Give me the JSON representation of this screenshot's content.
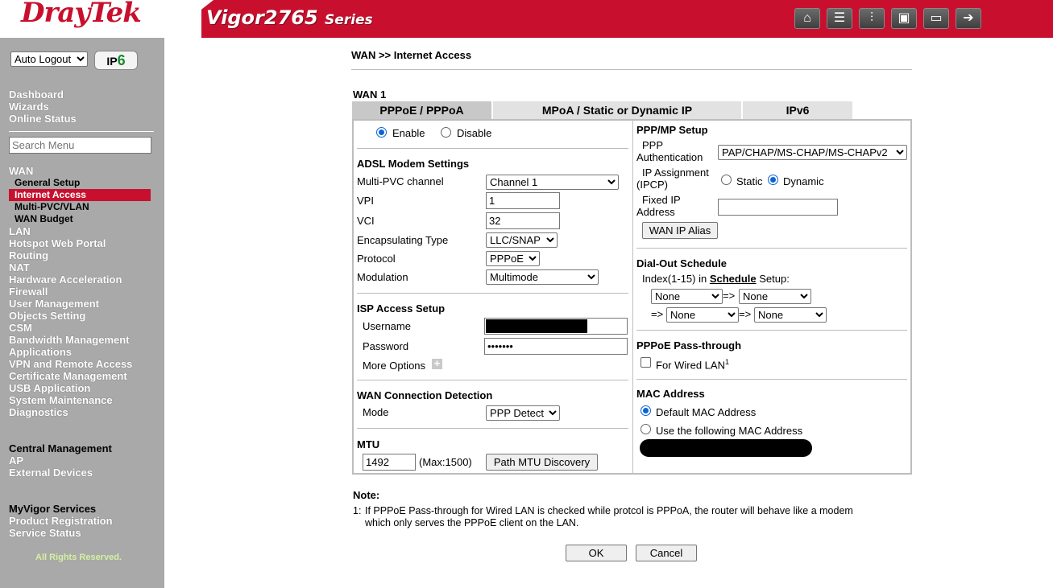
{
  "header": {
    "brand": "DrayTek",
    "model": "Vigor2765",
    "series": "Series",
    "icons": [
      "home-icon",
      "layout-icon",
      "sliders-icon",
      "save-icon",
      "book-icon",
      "logout-icon"
    ]
  },
  "sidebar": {
    "autologout": "Auto Logout",
    "ipv6_badge": "IPv6",
    "search_placeholder": "Search Menu",
    "top_items": [
      "Dashboard",
      "Wizards",
      "Online Status"
    ],
    "wan": "WAN",
    "wan_sub": [
      "General Setup",
      "Internet Access",
      "Multi-PVC/VLAN",
      "WAN Budget"
    ],
    "items": [
      "LAN",
      "Hotspot Web Portal",
      "Routing",
      "NAT",
      "Hardware Acceleration",
      "Firewall",
      "User Management",
      "Objects Setting",
      "CSM",
      "Bandwidth Management",
      "Applications",
      "VPN and Remote Access",
      "Certificate Management",
      "USB Application",
      "System Maintenance",
      "Diagnostics"
    ],
    "group2": [
      "Central Management",
      "AP",
      "External Devices"
    ],
    "group3": [
      "MyVigor Services",
      "Product Registration",
      "Service Status"
    ],
    "copyright": "All Rights Reserved."
  },
  "page": {
    "breadcrumb": "WAN >> Internet Access",
    "wan_title": "WAN 1",
    "tabs": [
      "PPPoE / PPPoA",
      "MPoA / Static or Dynamic IP",
      "IPv6"
    ]
  },
  "left": {
    "enable": "Enable",
    "disable": "Disable",
    "adsl_title": "ADSL Modem Settings",
    "multipvc_label": "Multi-PVC channel",
    "multipvc_value": "Channel 1",
    "vpi_label": "VPI",
    "vpi_value": "1",
    "vci_label": "VCI",
    "vci_value": "32",
    "encap_label": "Encapsulating Type",
    "encap_value": "LLC/SNAP",
    "protocol_label": "Protocol",
    "protocol_value": "PPPoE",
    "modulation_label": "Modulation",
    "modulation_value": "Multimode",
    "isp_title": "ISP Access Setup",
    "username_label": "Username",
    "password_label": "Password",
    "password_value": "•••••••",
    "more_options": "More Options",
    "detect_title": "WAN Connection Detection",
    "mode_label": "Mode",
    "mode_value": "PPP Detect",
    "mtu_title": "MTU",
    "mtu_value": "1492",
    "mtu_max": "(Max:1500)",
    "path_mtu_btn": "Path MTU Discovery"
  },
  "right": {
    "ppp_title": "PPP/MP Setup",
    "ppp_auth_label_1": "PPP",
    "ppp_auth_label_2": "Authentication",
    "ppp_auth_value": "PAP/CHAP/MS-CHAP/MS-CHAPv2",
    "ip_assign_label_1": "IP Assignment",
    "ip_assign_label_2": "(IPCP)",
    "static": "Static",
    "dynamic": "Dynamic",
    "fixed_ip_label_1": "Fixed IP",
    "fixed_ip_label_2": "Address",
    "wan_ip_alias_btn": "WAN IP Alias",
    "dialout_title": "Dial-Out Schedule",
    "index_prefix": "Index(1-15) in ",
    "schedule_link": "Schedule",
    "index_suffix": " Setup:",
    "sched_values": [
      "None",
      "None",
      "None",
      "None"
    ],
    "arrow": "=>",
    "passthrough_title": "PPPoE Pass-through",
    "wired_lan": "For Wired LAN",
    "wired_sup": "1",
    "mac_title": "MAC Address",
    "default_mac": "Default MAC Address",
    "use_mac": "Use the following MAC Address"
  },
  "note": {
    "title": "Note:",
    "num": "1:",
    "text_1": "If PPPoE Pass-through for Wired LAN is checked while protcol is PPPoA, the router will behave like a modem",
    "text_2": "which only serves the PPPoE client on the LAN."
  },
  "actions": {
    "ok": "OK",
    "cancel": "Cancel"
  }
}
